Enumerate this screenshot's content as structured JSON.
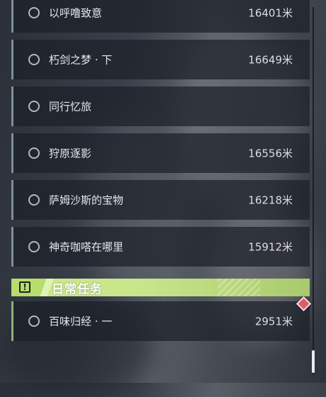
{
  "quest_list": {
    "items": [
      {
        "name": "以呼噜致意",
        "distance": "16401米"
      },
      {
        "name": "朽剑之梦 · 下",
        "distance": "16649米"
      },
      {
        "name": "同行忆旅",
        "distance": ""
      },
      {
        "name": "狩原逐影",
        "distance": "16556米"
      },
      {
        "name": "萨姆沙斯的宝物",
        "distance": "16218米"
      },
      {
        "name": "神奇咖嗒在哪里",
        "distance": "15912米"
      }
    ]
  },
  "daily_section": {
    "icon": "exclamation-icon",
    "title": "日常任务",
    "accent_color": "#cde98f",
    "items": [
      {
        "name": "百味归经 · 一",
        "distance": "2951米"
      }
    ]
  },
  "colors": {
    "list_bar": "#7f8f99",
    "daily_bar": "#8fb07a",
    "tracked_marker": "#e05a6a"
  }
}
